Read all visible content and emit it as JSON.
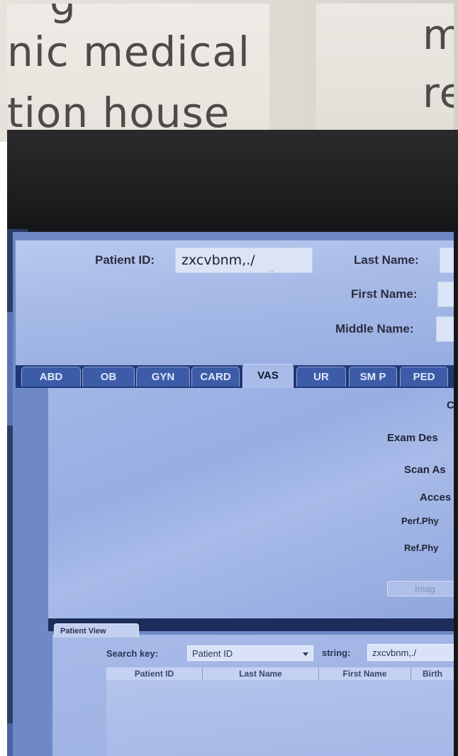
{
  "background_sign": {
    "line_top": "g",
    "line1": "nic medical",
    "line2": "tion house",
    "right_line1": "m",
    "right_line2": "re"
  },
  "patient_form": {
    "patient_id_label": "Patient ID:",
    "patient_id_value": "zxcvbnm,./",
    "last_name_label": "Last Name:",
    "first_name_label": "First Name:",
    "middle_name_label": "Middle Name:"
  },
  "tabs": [
    {
      "label": "ABD"
    },
    {
      "label": "OB"
    },
    {
      "label": "GYN"
    },
    {
      "label": "CARD"
    },
    {
      "label": "VAS",
      "active": true
    },
    {
      "label": "UR"
    },
    {
      "label": "SM P"
    },
    {
      "label": "PED"
    }
  ],
  "exam_panel": {
    "label_c": "C",
    "exam_desc_label": "Exam Des",
    "scan_as_label": "Scan As",
    "access_label": "Acces",
    "perf_phy_label": "Perf.Phy",
    "ref_phy_label": "Ref.Phy",
    "image_button": "Imag"
  },
  "patient_view": {
    "tab_label": "Patient View",
    "search_key_label": "Search key:",
    "search_key_value": "Patient ID",
    "string_label": "string:",
    "string_value": "zxcvbnm,./",
    "columns": [
      "Patient ID",
      "Last Name",
      "First Name",
      "Birth"
    ]
  },
  "colors": {
    "screen_blue": "#6f88c7",
    "panel_light": "#a8bbe8",
    "tab_dark": "#3d5ca8",
    "tab_active": "#a9bce9"
  }
}
